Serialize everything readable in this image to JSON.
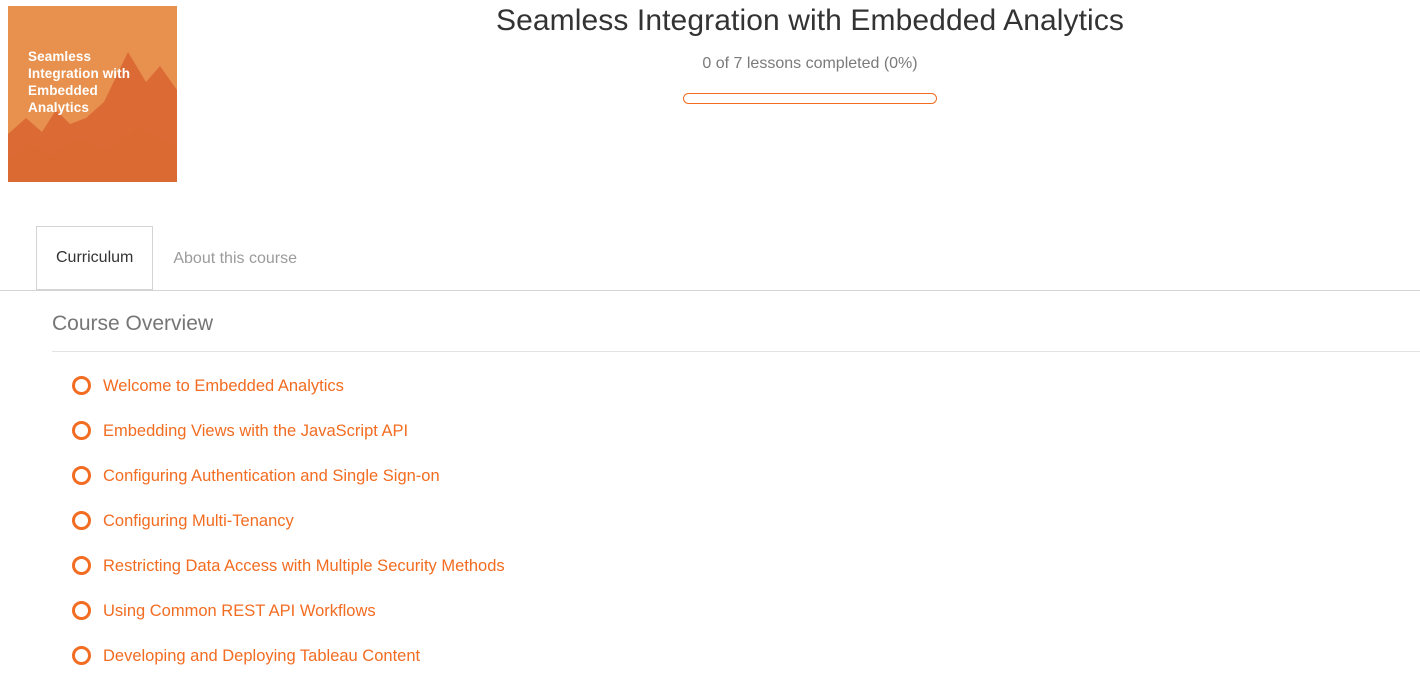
{
  "colors": {
    "brand_orange": "#f26c21",
    "thumb_light_orange": "#e8914e",
    "thumb_dark_orange": "#db6a35",
    "text_dark": "#333333",
    "text_muted": "#7a7a7a",
    "divider": "#d4d4d4"
  },
  "header": {
    "thumbnail": {
      "title": "Seamless\nIntegration with\nEmbedded\nAnalytics",
      "alt": "course-thumbnail"
    },
    "title": "Seamless Integration with Embedded Analytics",
    "progress_text": "0 of 7 lessons completed (0%)",
    "progress_percent": 0,
    "lessons_completed": 0,
    "lessons_total": 7
  },
  "tabs": [
    {
      "id": "curriculum",
      "label": "Curriculum",
      "active": true
    },
    {
      "id": "about",
      "label": "About this course",
      "active": false
    }
  ],
  "section": {
    "title": "Course Overview"
  },
  "lessons": [
    {
      "label": "Welcome to Embedded Analytics",
      "status": "incomplete",
      "icon": "circle-outline-icon"
    },
    {
      "label": "Embedding Views with the JavaScript API",
      "status": "incomplete",
      "icon": "circle-outline-icon"
    },
    {
      "label": "Configuring Authentication and Single Sign-on",
      "status": "incomplete",
      "icon": "circle-outline-icon"
    },
    {
      "label": "Configuring Multi-Tenancy",
      "status": "incomplete",
      "icon": "circle-outline-icon"
    },
    {
      "label": "Restricting Data Access with Multiple Security Methods",
      "status": "incomplete",
      "icon": "circle-outline-icon"
    },
    {
      "label": "Using Common REST API Workflows",
      "status": "incomplete",
      "icon": "circle-outline-icon"
    },
    {
      "label": "Developing and Deploying Tableau Content",
      "status": "incomplete",
      "icon": "circle-outline-icon"
    }
  ]
}
